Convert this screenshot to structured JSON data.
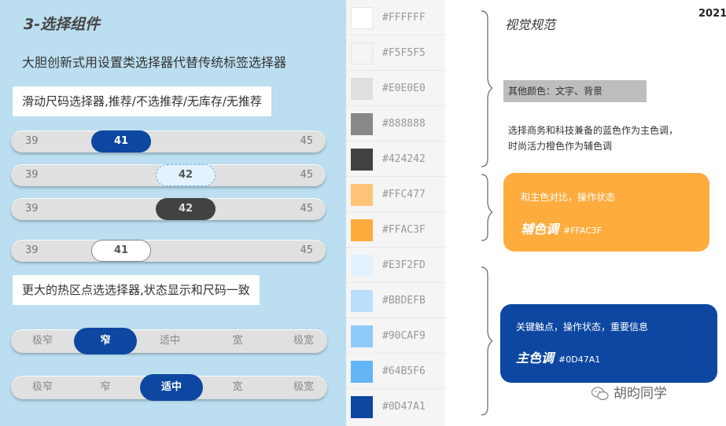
{
  "left": {
    "title": "3-选择组件",
    "subtitle": "大胆创新式用设置类选择器代替传统标签选择器",
    "label1": "滑动尺码选择器,推荐/不选推荐/无库存/无推荐",
    "label2": "更大的热区点选选择器,状态显示和尺码一致",
    "sliders": [
      {
        "min": "39",
        "max": "45",
        "value": "41"
      },
      {
        "min": "39",
        "max": "45",
        "value": "42"
      },
      {
        "min": "39",
        "max": "45",
        "value": "42"
      },
      {
        "min": "39",
        "max": "45",
        "value": "41"
      }
    ],
    "fit_selectors": [
      {
        "options": [
          "极窄",
          "窄",
          "适中",
          "宽",
          "极宽"
        ],
        "selected": "窄"
      },
      {
        "options": [
          "极窄",
          "窄",
          "适中",
          "宽",
          "极宽"
        ],
        "selected": "适中"
      }
    ]
  },
  "swatches": [
    {
      "hex": "#FFFFFF",
      "color": "#FFFFFF"
    },
    {
      "hex": "#F5F5F5",
      "color": "#F5F5F5"
    },
    {
      "hex": "#E0E0E0",
      "color": "#E0E0E0"
    },
    {
      "hex": "#888888",
      "color": "#888888"
    },
    {
      "hex": "#424242",
      "color": "#424242"
    },
    {
      "hex": "#FFC477",
      "color": "#FFC477"
    },
    {
      "hex": "#FFAC3F",
      "color": "#FFAC3F"
    },
    {
      "hex": "#E3F2FD",
      "color": "#E3F2FD"
    },
    {
      "hex": "#BBDEFB",
      "color": "#BBDEFB"
    },
    {
      "hex": "#90CAF9",
      "color": "#90CAF9"
    },
    {
      "hex": "#64B5F6",
      "color": "#64B5F6"
    },
    {
      "hex": "#0D47A1",
      "color": "#0D47A1"
    }
  ],
  "right": {
    "spec_title": "视觉规范",
    "year": "2021",
    "other_colors": "其他颜色：文字、背景",
    "desc_line1": "选择商务和科技兼备的蓝色作为主色调，",
    "desc_line2": "时尚活力橙色作为辅色调",
    "orange_card": {
      "sub": "和主色对比，操作状态",
      "main": "辅色调",
      "hex": "#FFAC3F"
    },
    "blue_card": {
      "sub": "关键触点，操作状态，重要信息",
      "main": "主色调",
      "hex": "#0D47A1"
    },
    "watermark": "胡昀同学"
  },
  "colors": {
    "accent_blue": "#0D47A1",
    "accent_orange": "#FFAC3F",
    "panel_bg": "#BBDEF0",
    "track": "#E0E0E0"
  }
}
